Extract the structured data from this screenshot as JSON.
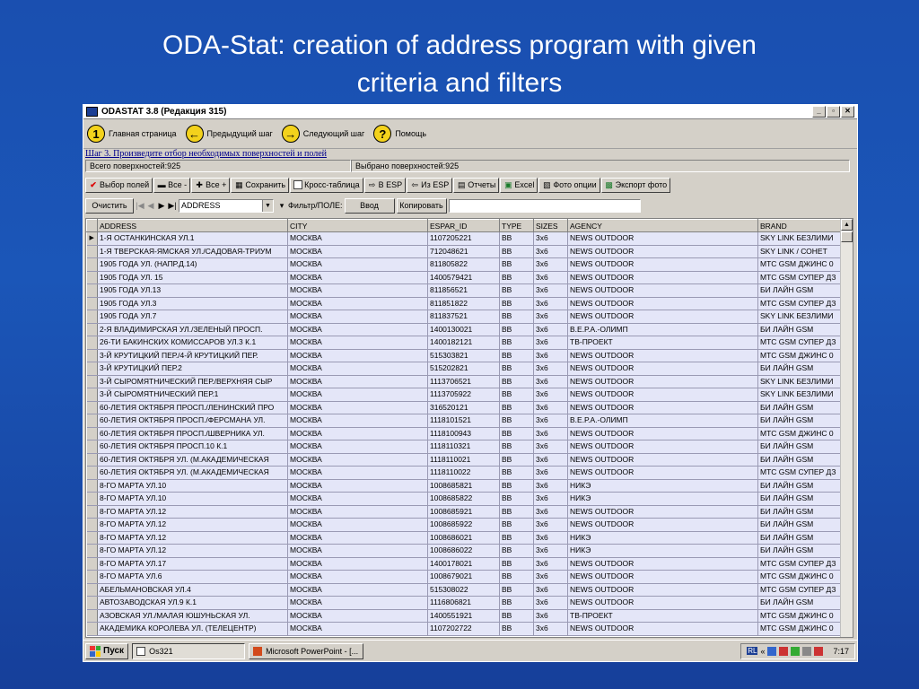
{
  "slide": {
    "title_line1": "ODA-Stat: creation of address program with given",
    "title_line2": "criteria and filters"
  },
  "window": {
    "title": "ODASTAT 3.8  (Редакция 315)"
  },
  "nav": [
    {
      "num": "1",
      "label": "Главная страница"
    },
    {
      "num": "←",
      "label": "Предыдущий шаг"
    },
    {
      "num": "→",
      "label": "Следующий шаг"
    },
    {
      "num": "?",
      "label": "Помощь"
    }
  ],
  "step": {
    "link": "Шаг 3. Произведите отбор необходимых поверхностей и полей"
  },
  "counts": {
    "total": "Всего поверхностей:925",
    "selected": "Выбрано поверхностей:925"
  },
  "toolbar": {
    "select_fields": "Выбор полей",
    "all_minus": "Все -",
    "all_plus": "Все +",
    "save": "Сохранить",
    "cross_table": "Кросс-таблица",
    "to_esp": "В ESP",
    "from_esp": "Из ESP",
    "reports": "Отчеты",
    "excel": "Excel",
    "photo_options": "Фото опции",
    "export_photo": "Экспорт фото"
  },
  "filter": {
    "clear": "Очистить",
    "field": "ADDRESS",
    "label": "Фильтр/ПОЛЕ:",
    "enter": "Ввод",
    "copy": "Копировать"
  },
  "table": {
    "columns": [
      "ADDRESS",
      "CITY",
      "ESPAR_ID",
      "TYPE",
      "SIZES",
      "AGENCY",
      "BRAND"
    ],
    "rows": [
      [
        "1-Я ОСТАНКИНСКАЯ УЛ.1",
        "МОСКВА",
        "1107205221",
        "BB",
        "3x6",
        "NEWS OUTDOOR",
        "SKY LINK БЕЗЛИМИ"
      ],
      [
        "1-Я ТВЕРСКАЯ-ЯМСКАЯ УЛ./САДОВАЯ-ТРИУМ",
        "МОСКВА",
        "712048621",
        "BB",
        "3x6",
        "NEWS OUTDOOR",
        "SKY LINK / СОНЕТ"
      ],
      [
        "1905 ГОДА УЛ. (НАПР.Д.14)",
        "МОСКВА",
        "811805822",
        "BB",
        "3x6",
        "NEWS OUTDOOR",
        "МТС GSM ДЖИНС 0"
      ],
      [
        "1905 ГОДА УЛ. 15",
        "МОСКВА",
        "1400579421",
        "BB",
        "3x6",
        "NEWS OUTDOOR",
        "МТС GSM СУПЕР ДЗ"
      ],
      [
        "1905 ГОДА УЛ.13",
        "МОСКВА",
        "811856521",
        "BB",
        "3x6",
        "NEWS OUTDOOR",
        "БИ ЛАЙН GSM"
      ],
      [
        "1905 ГОДА УЛ.3",
        "МОСКВА",
        "811851822",
        "BB",
        "3x6",
        "NEWS OUTDOOR",
        "МТС GSM СУПЕР ДЗ"
      ],
      [
        "1905 ГОДА УЛ.7",
        "МОСКВА",
        "811837521",
        "BB",
        "3x6",
        "NEWS OUTDOOR",
        "SKY LINK БЕЗЛИМИ"
      ],
      [
        "2-Я ВЛАДИМИРСКАЯ УЛ./ЗЕЛЕНЫЙ ПРОСП.",
        "МОСКВА",
        "1400130021",
        "BB",
        "3x6",
        "В.Е.Р.А.-ОЛИМП",
        "БИ ЛАЙН GSM"
      ],
      [
        "26-ТИ БАКИНСКИХ КОМИССАРОВ УЛ.3 К.1",
        "МОСКВА",
        "1400182121",
        "BB",
        "3x6",
        "ТВ-ПРОЕКТ",
        "МТС GSM СУПЕР ДЗ"
      ],
      [
        "3-Й КРУТИЦКИЙ ПЕР./4-Й КРУТИЦКИЙ ПЕР.",
        "МОСКВА",
        "515303821",
        "BB",
        "3x6",
        "NEWS OUTDOOR",
        "МТС GSM ДЖИНС 0"
      ],
      [
        "3-Й КРУТИЦКИЙ ПЕР.2",
        "МОСКВА",
        "515202821",
        "BB",
        "3x6",
        "NEWS OUTDOOR",
        "БИ ЛАЙН GSM"
      ],
      [
        "3-Й СЫРОМЯТНИЧЕСКИЙ ПЕР./ВЕРХНЯЯ СЫР",
        "МОСКВА",
        "1113706521",
        "BB",
        "3x6",
        "NEWS OUTDOOR",
        "SKY LINK БЕЗЛИМИ"
      ],
      [
        "3-Й СЫРОМЯТНИЧЕСКИЙ ПЕР.1",
        "МОСКВА",
        "1113705922",
        "BB",
        "3x6",
        "NEWS OUTDOOR",
        "SKY LINK БЕЗЛИМИ"
      ],
      [
        "60-ЛЕТИЯ ОКТЯБРЯ ПРОСП./ЛЕНИНСКИЙ ПРО",
        "МОСКВА",
        "316520121",
        "BB",
        "3x6",
        "NEWS OUTDOOR",
        "БИ ЛАЙН GSM"
      ],
      [
        "60-ЛЕТИЯ ОКТЯБРЯ ПРОСП./ФЕРСМАНА УЛ.",
        "МОСКВА",
        "1118101521",
        "BB",
        "3x6",
        "В.Е.Р.А.-ОЛИМП",
        "БИ ЛАЙН GSM"
      ],
      [
        "60-ЛЕТИЯ ОКТЯБРЯ ПРОСП./ШВЕРНИКА УЛ.",
        "МОСКВА",
        "1118100943",
        "BB",
        "3x6",
        "NEWS OUTDOOR",
        "МТС GSM ДЖИНС 0"
      ],
      [
        "60-ЛЕТИЯ ОКТЯБРЯ ПРОСП.10 К.1",
        "МОСКВА",
        "1118110321",
        "BB",
        "3x6",
        "NEWS OUTDOOR",
        "БИ ЛАЙН GSM"
      ],
      [
        "60-ЛЕТИЯ ОКТЯБРЯ УЛ. (М.АКАДЕМИЧЕСКАЯ",
        "МОСКВА",
        "1118110021",
        "BB",
        "3x6",
        "NEWS OUTDOOR",
        "БИ ЛАЙН GSM"
      ],
      [
        "60-ЛЕТИЯ ОКТЯБРЯ УЛ. (М.АКАДЕМИЧЕСКАЯ",
        "МОСКВА",
        "1118110022",
        "BB",
        "3x6",
        "NEWS OUTDOOR",
        "МТС GSM СУПЕР ДЗ"
      ],
      [
        "8-ГО МАРТА УЛ.10",
        "МОСКВА",
        "1008685821",
        "BB",
        "3x6",
        "НИКЭ",
        "БИ ЛАЙН GSM"
      ],
      [
        "8-ГО МАРТА УЛ.10",
        "МОСКВА",
        "1008685822",
        "BB",
        "3x6",
        "НИКЭ",
        "БИ ЛАЙН GSM"
      ],
      [
        "8-ГО МАРТА УЛ.12",
        "МОСКВА",
        "1008685921",
        "BB",
        "3x6",
        "NEWS OUTDOOR",
        "БИ ЛАЙН GSM"
      ],
      [
        "8-ГО МАРТА УЛ.12",
        "МОСКВА",
        "1008685922",
        "BB",
        "3x6",
        "NEWS OUTDOOR",
        "БИ ЛАЙН GSM"
      ],
      [
        "8-ГО МАРТА УЛ.12",
        "МОСКВА",
        "1008686021",
        "BB",
        "3x6",
        "НИКЭ",
        "БИ ЛАЙН GSM"
      ],
      [
        "8-ГО МАРТА УЛ.12",
        "МОСКВА",
        "1008686022",
        "BB",
        "3x6",
        "НИКЭ",
        "БИ ЛАЙН GSM"
      ],
      [
        "8-ГО МАРТА УЛ.17",
        "МОСКВА",
        "1400178021",
        "BB",
        "3x6",
        "NEWS OUTDOOR",
        "МТС GSM СУПЕР ДЗ"
      ],
      [
        "8-ГО МАРТА УЛ.6",
        "МОСКВА",
        "1008679021",
        "BB",
        "3x6",
        "NEWS OUTDOOR",
        "МТС GSM ДЖИНС 0"
      ],
      [
        "АБЕЛЬМАНОВСКАЯ УЛ.4",
        "МОСКВА",
        "515308022",
        "BB",
        "3x6",
        "NEWS OUTDOOR",
        "МТС GSM СУПЕР ДЗ"
      ],
      [
        "АВТОЗАВОДСКАЯ УЛ.9 К.1",
        "МОСКВА",
        "1116806821",
        "BB",
        "3x6",
        "NEWS OUTDOOR",
        "БИ ЛАЙН GSM"
      ],
      [
        "АЗОВСКАЯ УЛ./МАЛАЯ ЮШУНЬСКАЯ УЛ.",
        "МОСКВА",
        "1400551921",
        "BB",
        "3x6",
        "ТВ-ПРОЕКТ",
        "МТС GSM ДЖИНС 0"
      ],
      [
        "АКАДЕМИКА КОРОЛЕВА УЛ. (ТЕЛЕЦЕНТР)",
        "МОСКВА",
        "1107202722",
        "BB",
        "3x6",
        "NEWS OUTDOOR",
        "МТС GSM ДЖИНС 0"
      ]
    ]
  },
  "taskbar": {
    "start": "Пуск",
    "task1": "Os321",
    "task2": "Microsoft PowerPoint - [...",
    "lang": "RL",
    "time": "7:17"
  }
}
